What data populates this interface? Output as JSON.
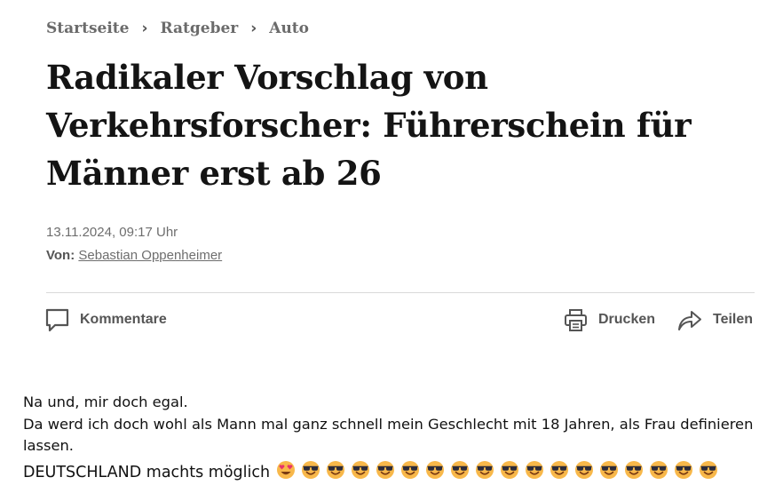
{
  "breadcrumb": {
    "items": [
      "Startseite",
      "Ratgeber",
      "Auto"
    ],
    "separator": "›"
  },
  "article": {
    "title": "Radikaler Vorschlag von Verkehrsforscher: Führerschein für Männer erst ab 26",
    "date": "13.11.2024, 09:17 Uhr",
    "author_label": "Von:",
    "author_name": "Sebastian Oppenheimer"
  },
  "actions": {
    "comments": "Kommentare",
    "print": "Drucken",
    "share": "Teilen"
  },
  "comment": {
    "line1": "Na und, mir doch egal.",
    "line2": "Da werd ich doch wohl als Mann mal ganz schnell mein Geschlecht mit 18 Jahren, als Frau definieren lassen.",
    "line3": "DEUTSCHLAND machts möglich",
    "emojis": [
      "heart-eyes-emoji",
      "sunglasses-emoji",
      "sunglasses-emoji",
      "sunglasses-emoji",
      "sunglasses-emoji",
      "sunglasses-emoji",
      "sunglasses-emoji",
      "sunglasses-emoji",
      "sunglasses-emoji",
      "sunglasses-emoji",
      "sunglasses-emoji",
      "sunglasses-emoji",
      "sunglasses-emoji",
      "sunglasses-emoji",
      "sunglasses-emoji",
      "sunglasses-emoji",
      "sunglasses-emoji",
      "sunglasses-emoji"
    ]
  },
  "colors": {
    "title": "#141414",
    "meta": "#6e6e6e",
    "divider": "#d9d9d9",
    "emoji_face": "#f8b84a",
    "emoji_glasses": "#2b2b3a",
    "emoji_heart": "#e8336b"
  }
}
